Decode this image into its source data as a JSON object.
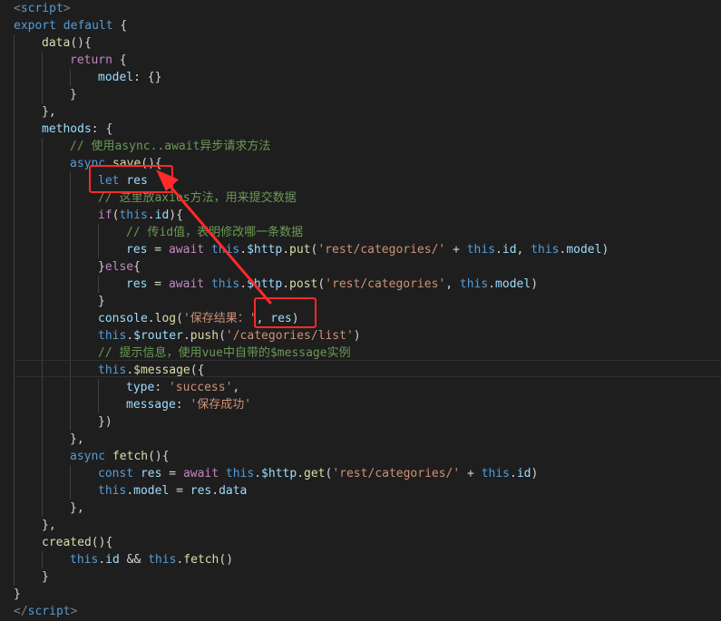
{
  "lines": [
    {
      "indent": 0,
      "tokens": [
        {
          "t": "<",
          "c": "tag"
        },
        {
          "t": "script",
          "c": "tagname"
        },
        {
          "t": ">",
          "c": "tag"
        }
      ]
    },
    {
      "indent": 0,
      "tokens": [
        {
          "t": "export default",
          "c": "kw"
        },
        {
          "t": " {",
          "c": "plain"
        }
      ]
    },
    {
      "indent": 1,
      "tokens": [
        {
          "t": "data",
          "c": "fn"
        },
        {
          "t": "(){",
          "c": "plain"
        }
      ]
    },
    {
      "indent": 2,
      "tokens": [
        {
          "t": "return",
          "c": "ctrl"
        },
        {
          "t": " {",
          "c": "plain"
        }
      ]
    },
    {
      "indent": 3,
      "tokens": [
        {
          "t": "model",
          "c": "var"
        },
        {
          "t": ": {}",
          "c": "plain"
        }
      ]
    },
    {
      "indent": 2,
      "tokens": [
        {
          "t": "}",
          "c": "plain"
        }
      ]
    },
    {
      "indent": 1,
      "tokens": [
        {
          "t": "},",
          "c": "plain"
        }
      ]
    },
    {
      "indent": 1,
      "tokens": [
        {
          "t": "methods",
          "c": "var"
        },
        {
          "t": ": {",
          "c": "plain"
        }
      ]
    },
    {
      "indent": 2,
      "tokens": [
        {
          "t": "// 使用async..await异步请求方法",
          "c": "cmt"
        }
      ]
    },
    {
      "indent": 2,
      "tokens": [
        {
          "t": "async",
          "c": "kw"
        },
        {
          "t": " ",
          "c": "plain"
        },
        {
          "t": "save",
          "c": "fn"
        },
        {
          "t": "(){",
          "c": "plain"
        }
      ]
    },
    {
      "indent": 3,
      "tokens": [
        {
          "t": "let",
          "c": "kw"
        },
        {
          "t": " ",
          "c": "plain"
        },
        {
          "t": "res",
          "c": "var"
        }
      ]
    },
    {
      "indent": 3,
      "tokens": [
        {
          "t": "// 这里放axios方法，用来提交数据",
          "c": "cmt"
        }
      ]
    },
    {
      "indent": 3,
      "tokens": [
        {
          "t": "if",
          "c": "ctrl"
        },
        {
          "t": "(",
          "c": "plain"
        },
        {
          "t": "this",
          "c": "kw"
        },
        {
          "t": ".",
          "c": "plain"
        },
        {
          "t": "id",
          "c": "var"
        },
        {
          "t": "){",
          "c": "plain"
        }
      ]
    },
    {
      "indent": 4,
      "tokens": [
        {
          "t": "// 传id值，表明修改哪一条数据",
          "c": "cmt"
        }
      ]
    },
    {
      "indent": 4,
      "tokens": [
        {
          "t": "res",
          "c": "var"
        },
        {
          "t": " = ",
          "c": "plain"
        },
        {
          "t": "await",
          "c": "ctrl"
        },
        {
          "t": " ",
          "c": "plain"
        },
        {
          "t": "this",
          "c": "kw"
        },
        {
          "t": ".",
          "c": "plain"
        },
        {
          "t": "$http",
          "c": "var"
        },
        {
          "t": ".",
          "c": "plain"
        },
        {
          "t": "put",
          "c": "fn"
        },
        {
          "t": "(",
          "c": "plain"
        },
        {
          "t": "'rest/categories/'",
          "c": "str"
        },
        {
          "t": " + ",
          "c": "plain"
        },
        {
          "t": "this",
          "c": "kw"
        },
        {
          "t": ".",
          "c": "plain"
        },
        {
          "t": "id",
          "c": "var"
        },
        {
          "t": ", ",
          "c": "plain"
        },
        {
          "t": "this",
          "c": "kw"
        },
        {
          "t": ".",
          "c": "plain"
        },
        {
          "t": "model",
          "c": "var"
        },
        {
          "t": ")",
          "c": "plain"
        }
      ]
    },
    {
      "indent": 3,
      "tokens": [
        {
          "t": "}",
          "c": "plain"
        },
        {
          "t": "else",
          "c": "ctrl"
        },
        {
          "t": "{",
          "c": "plain"
        }
      ]
    },
    {
      "indent": 4,
      "tokens": [
        {
          "t": "res",
          "c": "var"
        },
        {
          "t": " = ",
          "c": "plain"
        },
        {
          "t": "await",
          "c": "ctrl"
        },
        {
          "t": " ",
          "c": "plain"
        },
        {
          "t": "this",
          "c": "kw"
        },
        {
          "t": ".",
          "c": "plain"
        },
        {
          "t": "$http",
          "c": "var"
        },
        {
          "t": ".",
          "c": "plain"
        },
        {
          "t": "post",
          "c": "fn"
        },
        {
          "t": "(",
          "c": "plain"
        },
        {
          "t": "'rest/categories'",
          "c": "str"
        },
        {
          "t": ", ",
          "c": "plain"
        },
        {
          "t": "this",
          "c": "kw"
        },
        {
          "t": ".",
          "c": "plain"
        },
        {
          "t": "model",
          "c": "var"
        },
        {
          "t": ")",
          "c": "plain"
        }
      ]
    },
    {
      "indent": 3,
      "tokens": [
        {
          "t": "}",
          "c": "plain"
        }
      ]
    },
    {
      "indent": 3,
      "tokens": [
        {
          "t": "console",
          "c": "var"
        },
        {
          "t": ".",
          "c": "plain"
        },
        {
          "t": "log",
          "c": "fn"
        },
        {
          "t": "(",
          "c": "plain"
        },
        {
          "t": "'保存结果：'",
          "c": "str"
        },
        {
          "t": ", ",
          "c": "plain"
        },
        {
          "t": "res",
          "c": "var"
        },
        {
          "t": ")",
          "c": "plain"
        }
      ]
    },
    {
      "indent": 3,
      "tokens": [
        {
          "t": "this",
          "c": "kw"
        },
        {
          "t": ".",
          "c": "plain"
        },
        {
          "t": "$router",
          "c": "var"
        },
        {
          "t": ".",
          "c": "plain"
        },
        {
          "t": "push",
          "c": "fn"
        },
        {
          "t": "(",
          "c": "plain"
        },
        {
          "t": "'/categories/list'",
          "c": "str"
        },
        {
          "t": ")",
          "c": "plain"
        }
      ]
    },
    {
      "indent": 3,
      "tokens": [
        {
          "t": "// 提示信息，使用vue中自带的$message实例",
          "c": "cmt"
        }
      ]
    },
    {
      "indent": 3,
      "tokens": [
        {
          "t": "this",
          "c": "kw"
        },
        {
          "t": ".",
          "c": "plain"
        },
        {
          "t": "$message",
          "c": "fn"
        },
        {
          "t": "({",
          "c": "plain"
        }
      ]
    },
    {
      "indent": 4,
      "tokens": [
        {
          "t": "type",
          "c": "var"
        },
        {
          "t": ": ",
          "c": "plain"
        },
        {
          "t": "'success'",
          "c": "str"
        },
        {
          "t": ",",
          "c": "plain"
        }
      ]
    },
    {
      "indent": 4,
      "tokens": [
        {
          "t": "message",
          "c": "var"
        },
        {
          "t": ": ",
          "c": "plain"
        },
        {
          "t": "'保存成功'",
          "c": "str"
        }
      ]
    },
    {
      "indent": 3,
      "tokens": [
        {
          "t": "})",
          "c": "plain"
        }
      ]
    },
    {
      "indent": 2,
      "tokens": [
        {
          "t": "},",
          "c": "plain"
        }
      ]
    },
    {
      "indent": 2,
      "tokens": [
        {
          "t": "async",
          "c": "kw"
        },
        {
          "t": " ",
          "c": "plain"
        },
        {
          "t": "fetch",
          "c": "fn"
        },
        {
          "t": "(){",
          "c": "plain"
        }
      ]
    },
    {
      "indent": 3,
      "tokens": [
        {
          "t": "const",
          "c": "kw"
        },
        {
          "t": " ",
          "c": "plain"
        },
        {
          "t": "res",
          "c": "var"
        },
        {
          "t": " = ",
          "c": "plain"
        },
        {
          "t": "await",
          "c": "ctrl"
        },
        {
          "t": " ",
          "c": "plain"
        },
        {
          "t": "this",
          "c": "kw"
        },
        {
          "t": ".",
          "c": "plain"
        },
        {
          "t": "$http",
          "c": "var"
        },
        {
          "t": ".",
          "c": "plain"
        },
        {
          "t": "get",
          "c": "fn"
        },
        {
          "t": "(",
          "c": "plain"
        },
        {
          "t": "'rest/categories/'",
          "c": "str"
        },
        {
          "t": " + ",
          "c": "plain"
        },
        {
          "t": "this",
          "c": "kw"
        },
        {
          "t": ".",
          "c": "plain"
        },
        {
          "t": "id",
          "c": "var"
        },
        {
          "t": ")",
          "c": "plain"
        }
      ]
    },
    {
      "indent": 3,
      "tokens": [
        {
          "t": "this",
          "c": "kw"
        },
        {
          "t": ".",
          "c": "plain"
        },
        {
          "t": "model",
          "c": "var"
        },
        {
          "t": " = ",
          "c": "plain"
        },
        {
          "t": "res",
          "c": "var"
        },
        {
          "t": ".",
          "c": "plain"
        },
        {
          "t": "data",
          "c": "var"
        }
      ]
    },
    {
      "indent": 2,
      "tokens": [
        {
          "t": "},",
          "c": "plain"
        }
      ]
    },
    {
      "indent": 1,
      "tokens": [
        {
          "t": "},",
          "c": "plain"
        }
      ]
    },
    {
      "indent": 1,
      "tokens": [
        {
          "t": "created",
          "c": "fn"
        },
        {
          "t": "(){",
          "c": "plain"
        }
      ]
    },
    {
      "indent": 2,
      "tokens": [
        {
          "t": "this",
          "c": "kw"
        },
        {
          "t": ".",
          "c": "plain"
        },
        {
          "t": "id",
          "c": "var"
        },
        {
          "t": " && ",
          "c": "plain"
        },
        {
          "t": "this",
          "c": "kw"
        },
        {
          "t": ".",
          "c": "plain"
        },
        {
          "t": "fetch",
          "c": "fn"
        },
        {
          "t": "()",
          "c": "plain"
        }
      ]
    },
    {
      "indent": 1,
      "tokens": [
        {
          "t": "}",
          "c": "plain"
        }
      ]
    },
    {
      "indent": 0,
      "tokens": [
        {
          "t": "}",
          "c": "plain"
        }
      ]
    },
    {
      "indent": 0,
      "tokens": [
        {
          "t": "</",
          "c": "tag"
        },
        {
          "t": "script",
          "c": "tagname"
        },
        {
          "t": ">",
          "c": "tag"
        }
      ]
    }
  ],
  "theme": {
    "background": "#1e1e1e",
    "annotation_color": "#ff2a2a"
  },
  "annotations": {
    "box_declaration": "let res",
    "box_usage": ", res)",
    "arrow_icon": "arrow-icon"
  }
}
